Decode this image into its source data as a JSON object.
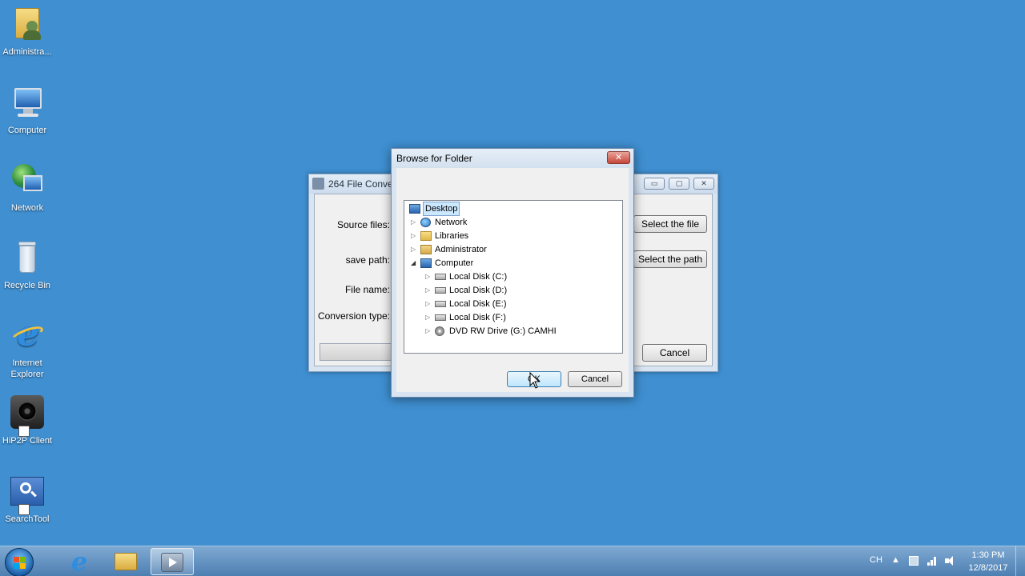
{
  "desktop": {
    "icons": [
      {
        "label": "Administra...",
        "icon": "user-folder-icon"
      },
      {
        "label": "Computer",
        "icon": "computer-icon"
      },
      {
        "label": "Network",
        "icon": "network-icon"
      },
      {
        "label": "Recycle Bin",
        "icon": "recycle-bin-icon"
      },
      {
        "label": "Internet Explorer",
        "icon": "internet-explorer-icon"
      },
      {
        "label": "HiP2P Client",
        "icon": "camera-icon"
      },
      {
        "label": "SearchTool",
        "icon": "search-icon"
      }
    ]
  },
  "app_window": {
    "title": "264 File Convers",
    "labels": {
      "source_files": "Source files:",
      "save_path": "save path:",
      "file_name": "File name:",
      "conversion_type": "Conversion type:"
    },
    "buttons": {
      "select_file": "Select the file",
      "select_path": "Select the path",
      "cancel": "Cancel"
    },
    "controls": {
      "minimize": "▭",
      "maximize": "▢",
      "close": "✕"
    }
  },
  "browse_dialog": {
    "title": "Browse for Folder",
    "close_glyph": "✕",
    "tree": [
      {
        "label": "Desktop",
        "icon": "desktop-icon",
        "selected": true,
        "expander": ""
      },
      {
        "label": "Network",
        "icon": "network-icon",
        "expander": "▷"
      },
      {
        "label": "Libraries",
        "icon": "libraries-icon",
        "expander": "▷"
      },
      {
        "label": "Administrator",
        "icon": "user-folder-icon",
        "expander": "▷"
      },
      {
        "label": "Computer",
        "icon": "computer-icon",
        "expander": "◢"
      },
      {
        "label": "Local Disk (C:)",
        "icon": "system-disk-icon",
        "expander": "▷"
      },
      {
        "label": "Local Disk (D:)",
        "icon": "disk-icon",
        "expander": "▷"
      },
      {
        "label": "Local Disk (E:)",
        "icon": "disk-icon",
        "expander": "▷"
      },
      {
        "label": "Local Disk (F:)",
        "icon": "disk-icon",
        "expander": "▷"
      },
      {
        "label": "DVD RW Drive (G:) CAMHI",
        "icon": "dvd-icon",
        "expander": "▷"
      }
    ],
    "ok_label": "OK",
    "cancel_label": "Cancel"
  },
  "taskbar": {
    "pinned": [
      "internet-explorer-icon",
      "file-explorer-icon",
      "media-player-icon"
    ],
    "tray": {
      "language": "CH",
      "time": "1:30 PM",
      "date": "12/8/2017"
    }
  }
}
